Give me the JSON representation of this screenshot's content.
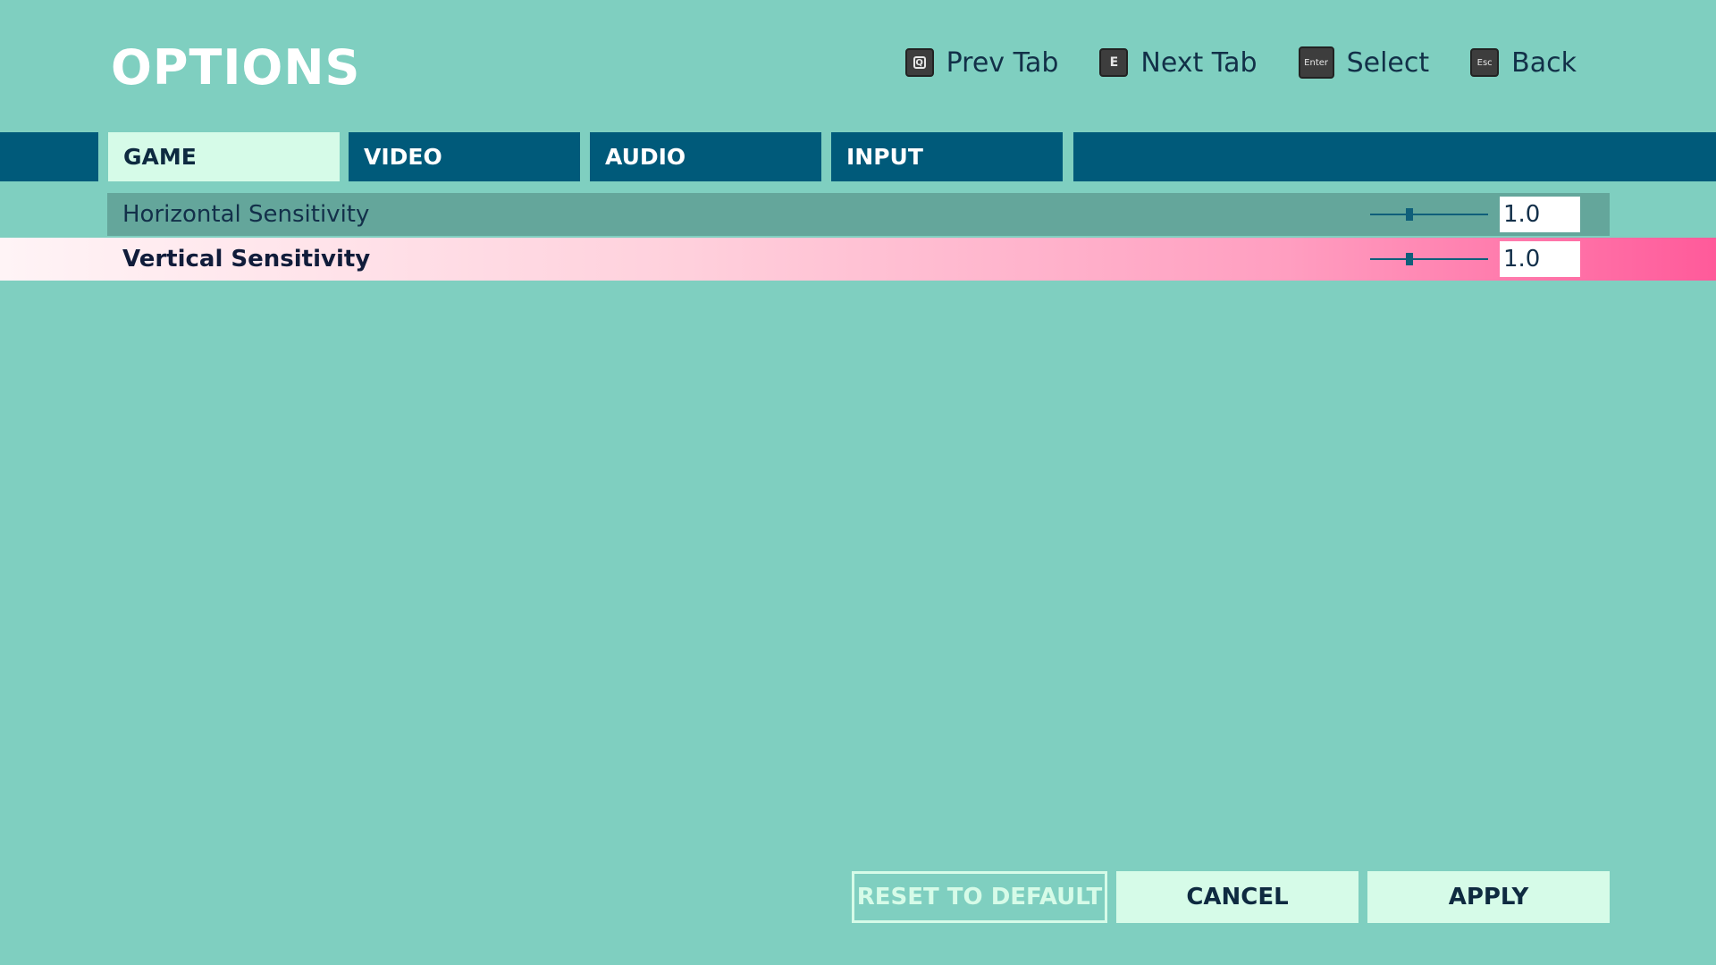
{
  "header": {
    "title": "OPTIONS"
  },
  "hints": [
    {
      "key": "Q",
      "label": "Prev Tab",
      "icon": "q-key-icon"
    },
    {
      "key": "E",
      "label": "Next Tab",
      "icon": "e-key-icon"
    },
    {
      "key": "Enter",
      "label": "Select",
      "icon": "enter-key-icon"
    },
    {
      "key": "Esc",
      "label": "Back",
      "icon": "esc-key-icon"
    }
  ],
  "tabs": [
    {
      "label": "GAME",
      "active": true
    },
    {
      "label": "VIDEO",
      "active": false
    },
    {
      "label": "AUDIO",
      "active": false
    },
    {
      "label": "INPUT",
      "active": false
    }
  ],
  "settings": [
    {
      "label": "Horizontal Sensitivity",
      "value": "1.0",
      "slider_fraction": 0.33,
      "selected": false
    },
    {
      "label": "Vertical Sensitivity",
      "value": "1.0",
      "slider_fraction": 0.33,
      "selected": true
    }
  ],
  "buttons": {
    "reset": "RESET TO DEFAULT",
    "cancel": "CANCEL",
    "apply": "APPLY"
  },
  "colors": {
    "background": "#7fcfc0",
    "tab": "#005a7a",
    "tab_active": "#d6fbe8",
    "row": "#64a69b",
    "selected_end": "#ff5a9a"
  }
}
